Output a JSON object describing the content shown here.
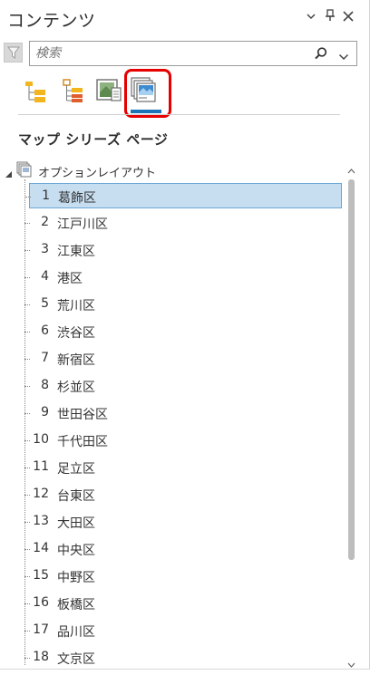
{
  "panel": {
    "title": "コンテンツ"
  },
  "search": {
    "placeholder": "検索",
    "value": ""
  },
  "views": [
    {
      "icon": "drawing-order-icon"
    },
    {
      "icon": "source-list-icon"
    },
    {
      "icon": "map-frame-icon"
    },
    {
      "icon": "map-series-pages-icon",
      "active": true
    }
  ],
  "section": {
    "title": "マップ シリーズ ページ"
  },
  "tree": {
    "root_label": "オプションレイアウト",
    "pages": [
      {
        "num": "1",
        "name": "葛飾区"
      },
      {
        "num": "2",
        "name": "江戸川区"
      },
      {
        "num": "3",
        "name": "江東区"
      },
      {
        "num": "4",
        "name": "港区"
      },
      {
        "num": "5",
        "name": "荒川区"
      },
      {
        "num": "6",
        "name": "渋谷区"
      },
      {
        "num": "7",
        "name": "新宿区"
      },
      {
        "num": "8",
        "name": "杉並区"
      },
      {
        "num": "9",
        "name": "世田谷区"
      },
      {
        "num": "10",
        "name": "千代田区"
      },
      {
        "num": "11",
        "name": "足立区"
      },
      {
        "num": "12",
        "name": "台東区"
      },
      {
        "num": "13",
        "name": "大田区"
      },
      {
        "num": "14",
        "name": "中央区"
      },
      {
        "num": "15",
        "name": "中野区"
      },
      {
        "num": "16",
        "name": "板橋区"
      },
      {
        "num": "17",
        "name": "品川区"
      },
      {
        "num": "18",
        "name": "文京区"
      }
    ],
    "selected_index": 0
  },
  "colors": {
    "accent": "#1c74b8",
    "highlight": "#e60000",
    "selection": "#c7def1"
  }
}
